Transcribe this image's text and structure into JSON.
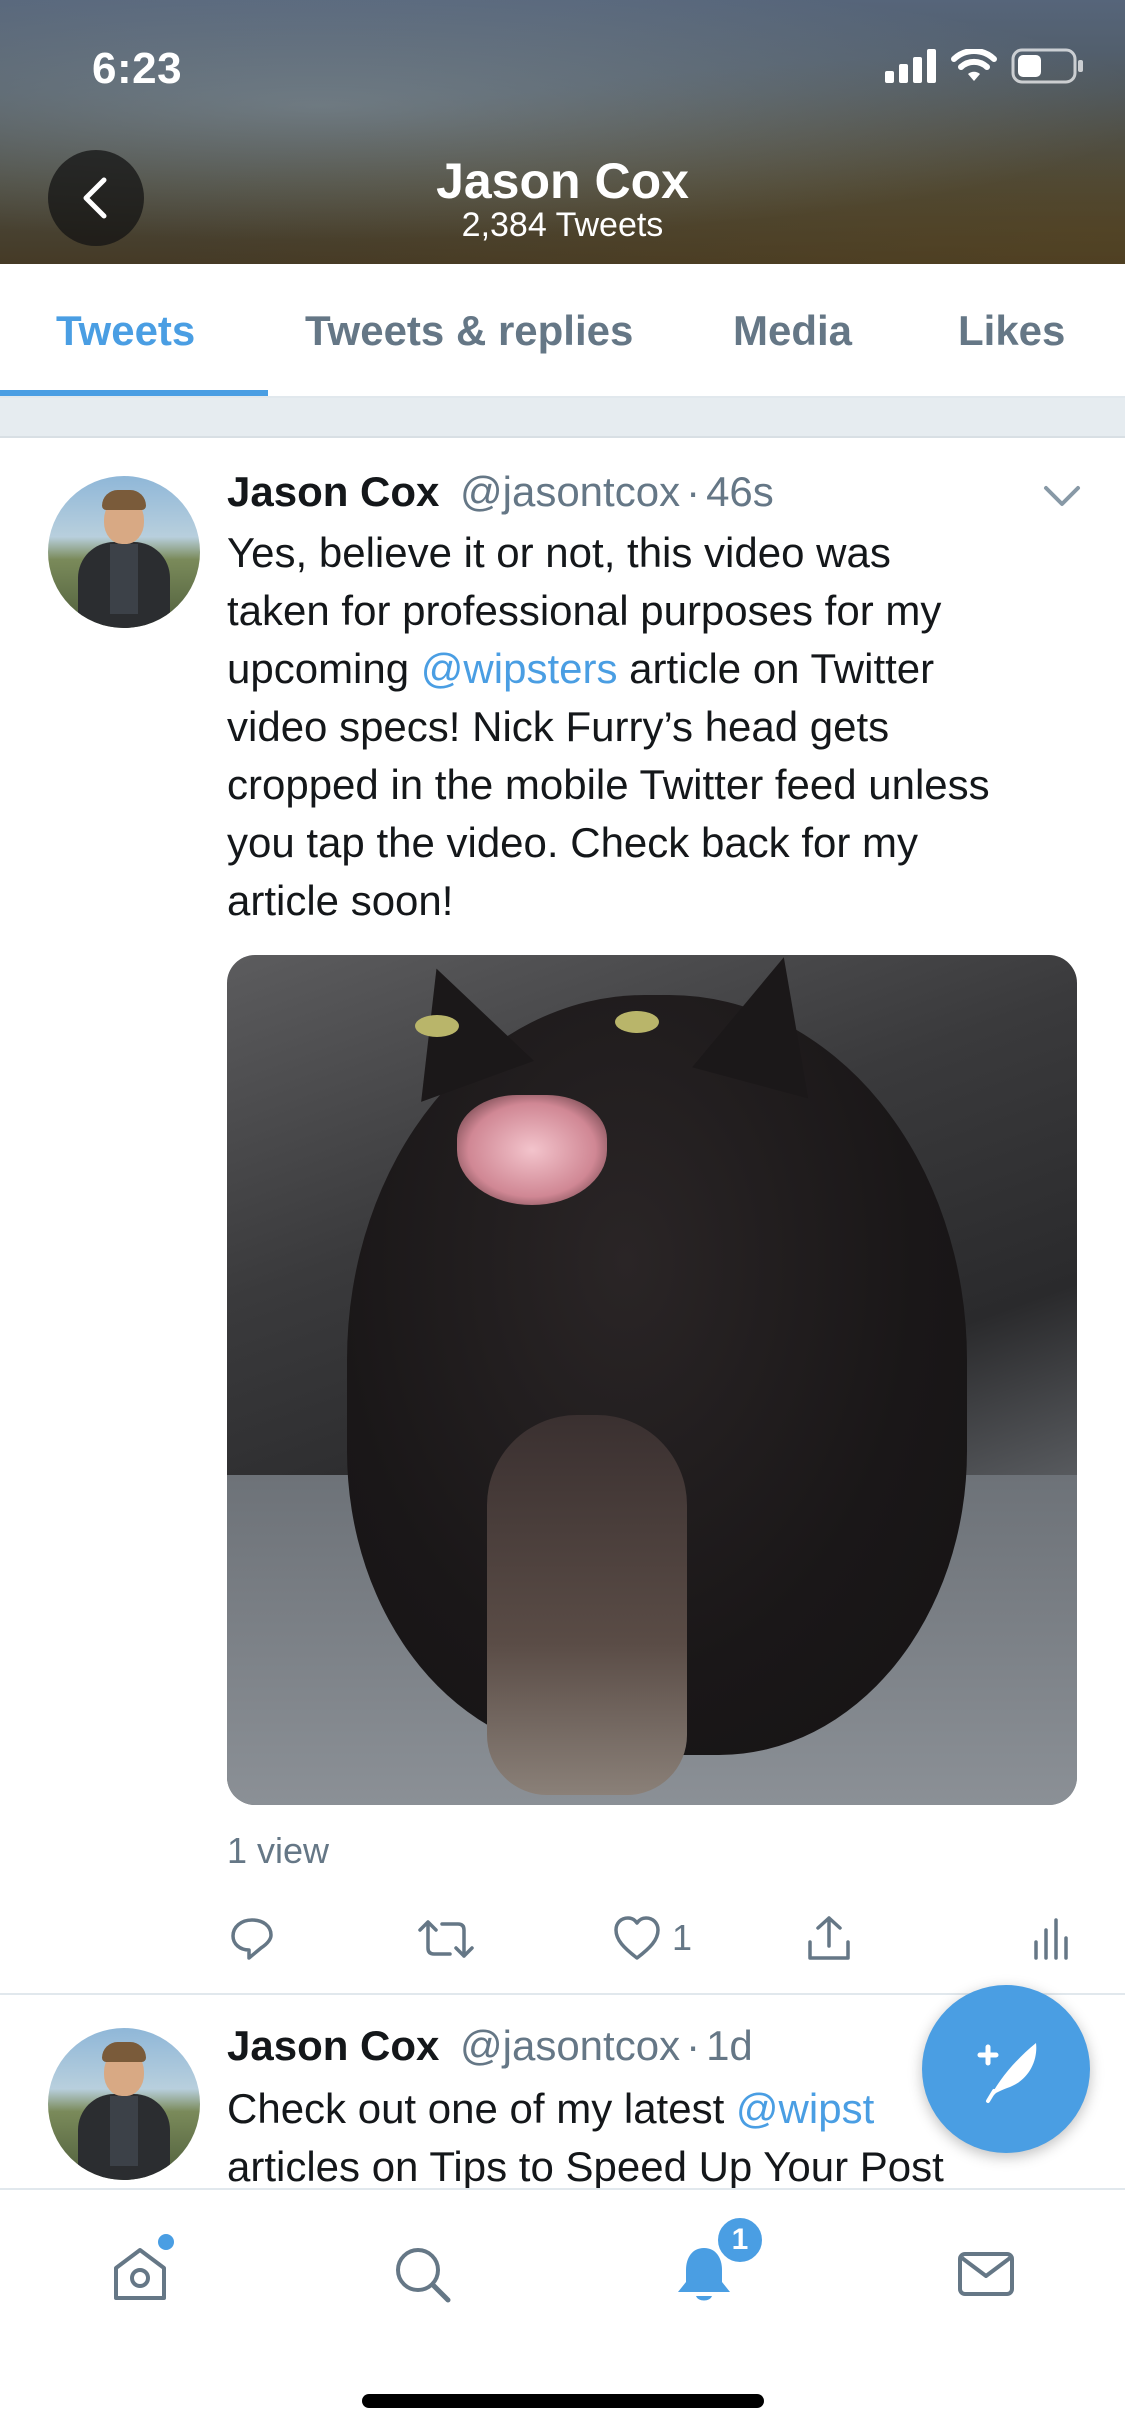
{
  "status_bar": {
    "time": "6:23",
    "battery_level": 0.45
  },
  "header": {
    "title": "Jason Cox",
    "subtitle": "2,384 Tweets"
  },
  "tabs": [
    {
      "label": "Tweets",
      "active": true
    },
    {
      "label": "Tweets & replies",
      "active": false
    },
    {
      "label": "Media",
      "active": false
    },
    {
      "label": "Likes",
      "active": false
    }
  ],
  "tweets": [
    {
      "author": "Jason Cox",
      "handle": "@jasontcox",
      "sep": "·",
      "time": "46s",
      "lines": [
        {
          "text": "Yes, believe it or not, this video was"
        },
        {
          "text": "taken for professional purposes for my"
        },
        {
          "pre": "upcoming ",
          "mention": "@wipsters",
          "post": " article on Twitter"
        },
        {
          "text": "video specs! Nick Furry’s head gets"
        },
        {
          "text": "cropped in the mobile Twitter feed unless"
        },
        {
          "text": "you tap the video. Check back for my"
        },
        {
          "text": "article soon!"
        }
      ],
      "views": "1 view",
      "like_count": "1"
    },
    {
      "author": "Jason Cox",
      "handle": "@jasontcox",
      "sep": "·",
      "time": "1d",
      "line1_pre": "Check out one of my latest ",
      "line1_mention": "@wipst",
      "line2": "articles on Tips to Speed Up Your Post"
    }
  ],
  "bottom_nav": {
    "notifications_badge": "1"
  },
  "colors": {
    "accent": "#4a9ee3",
    "muted": "#657786",
    "text": "#14171a"
  }
}
